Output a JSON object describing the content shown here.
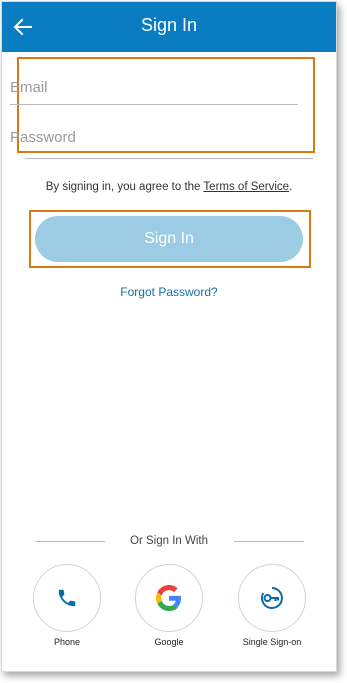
{
  "header": {
    "title": "Sign In",
    "back_icon": "arrow-left-icon",
    "background_color": "#0a7cc2"
  },
  "form": {
    "email_placeholder": "Email",
    "email_value": "",
    "password_placeholder": "Password",
    "password_value": ""
  },
  "terms": {
    "prefix": "By signing in, you agree to the ",
    "link": "Terms of Service",
    "suffix": "."
  },
  "sign_in_button": {
    "label": "Sign In",
    "color": "#9ccbe4"
  },
  "forgot_password": {
    "label": "Forgot Password?",
    "color": "#1a6fa3"
  },
  "alternate": {
    "heading": "Or Sign In With",
    "options": [
      {
        "label": "Phone",
        "icon": "phone-icon"
      },
      {
        "label": "Google",
        "icon": "google-icon"
      },
      {
        "label": "Single Sign-on",
        "icon": "key-icon"
      }
    ]
  },
  "highlight_color": "#d97a10"
}
